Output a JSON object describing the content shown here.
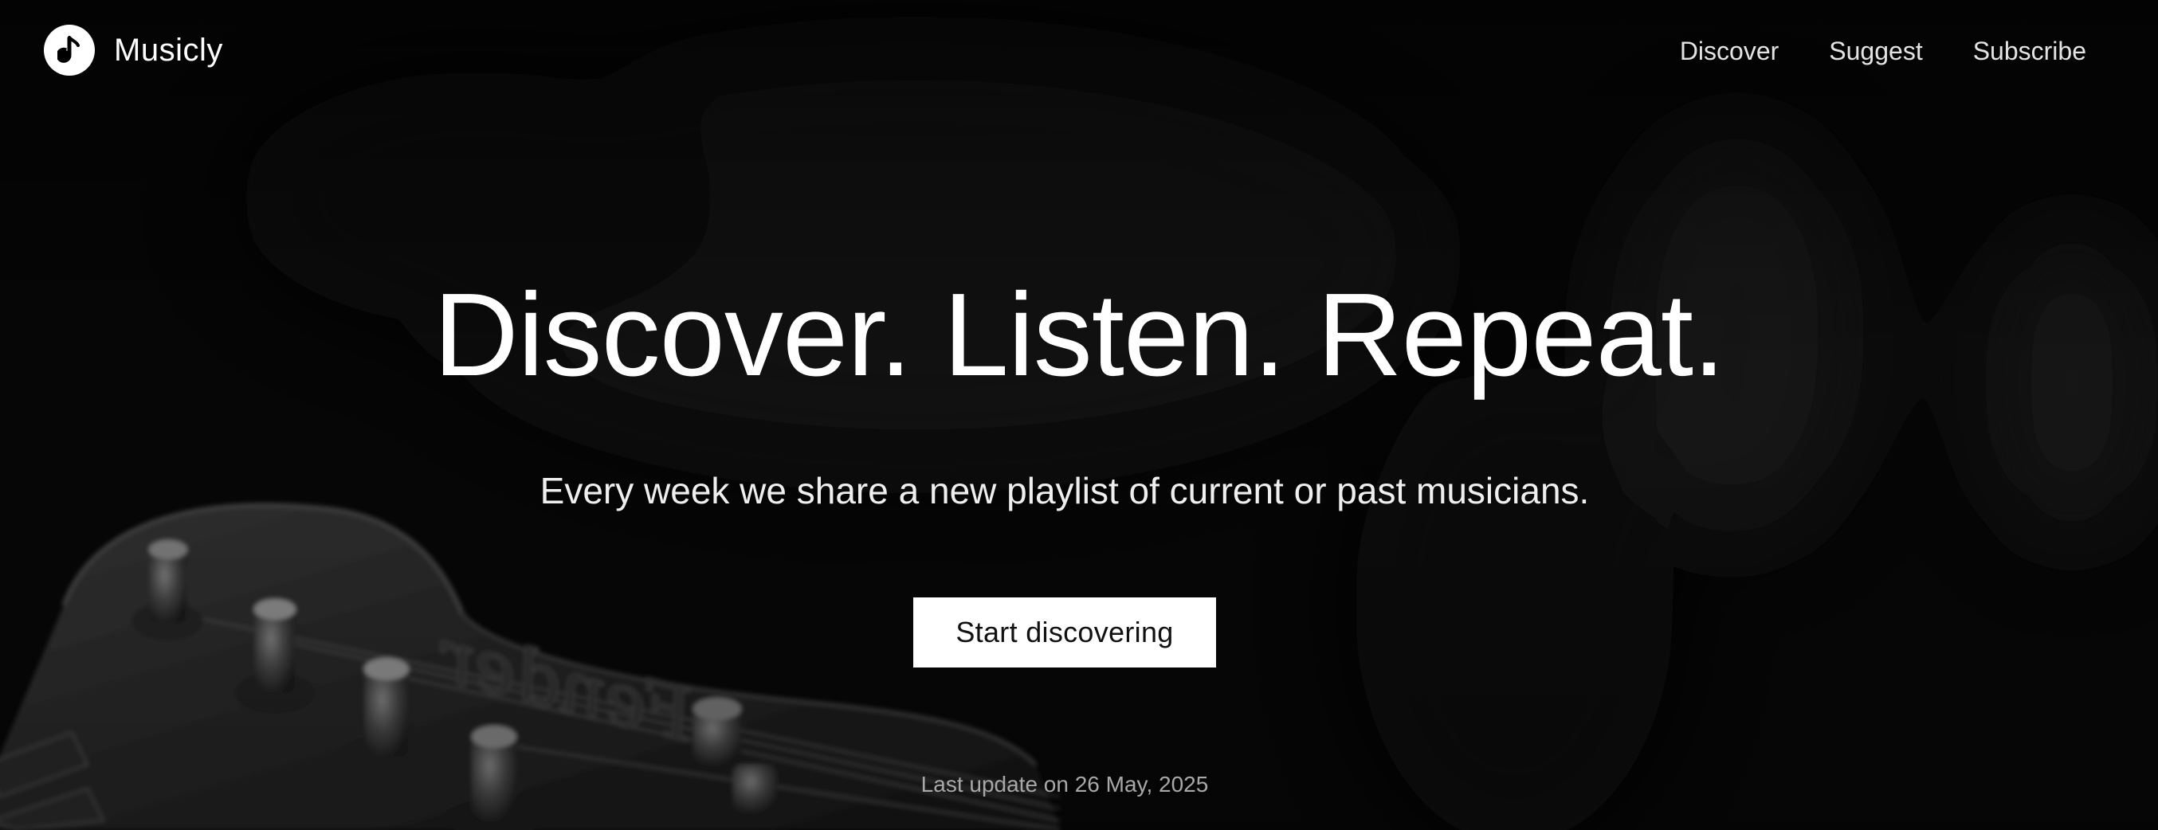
{
  "brand": {
    "name": "Musicly",
    "logo_icon": "music-note-icon"
  },
  "nav": {
    "items": [
      {
        "label": "Discover"
      },
      {
        "label": "Suggest"
      },
      {
        "label": "Subscribe"
      }
    ]
  },
  "hero": {
    "headline": "Discover. Listen. Repeat.",
    "subheadline": "Every week we share a new playlist of current or past musicians.",
    "cta_label": "Start discovering",
    "last_update": "Last update on 26 May, 2025",
    "background_image": "guitar-headstock-photo"
  },
  "colors": {
    "background": "#050505",
    "text": "#ffffff",
    "nav_text": "#e4e4e4",
    "muted_text": "#a8a8a8",
    "button_bg": "#ffffff",
    "button_text": "#111111"
  }
}
